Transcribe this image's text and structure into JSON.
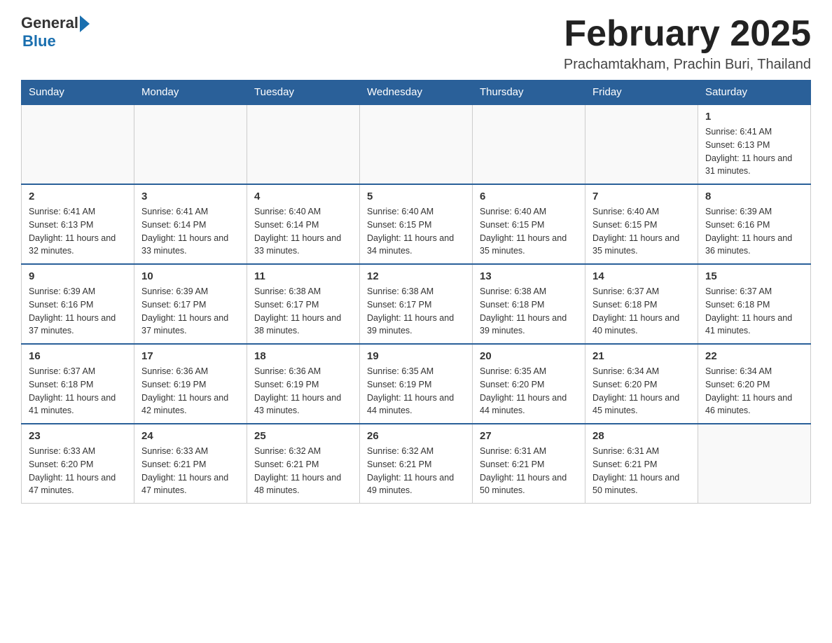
{
  "header": {
    "logo_general": "General",
    "logo_blue": "Blue",
    "month_title": "February 2025",
    "location": "Prachamtakham, Prachin Buri, Thailand"
  },
  "days_of_week": [
    "Sunday",
    "Monday",
    "Tuesday",
    "Wednesday",
    "Thursday",
    "Friday",
    "Saturday"
  ],
  "weeks": [
    {
      "days": [
        {
          "date": "",
          "info": ""
        },
        {
          "date": "",
          "info": ""
        },
        {
          "date": "",
          "info": ""
        },
        {
          "date": "",
          "info": ""
        },
        {
          "date": "",
          "info": ""
        },
        {
          "date": "",
          "info": ""
        },
        {
          "date": "1",
          "info": "Sunrise: 6:41 AM\nSunset: 6:13 PM\nDaylight: 11 hours and 31 minutes."
        }
      ]
    },
    {
      "days": [
        {
          "date": "2",
          "info": "Sunrise: 6:41 AM\nSunset: 6:13 PM\nDaylight: 11 hours and 32 minutes."
        },
        {
          "date": "3",
          "info": "Sunrise: 6:41 AM\nSunset: 6:14 PM\nDaylight: 11 hours and 33 minutes."
        },
        {
          "date": "4",
          "info": "Sunrise: 6:40 AM\nSunset: 6:14 PM\nDaylight: 11 hours and 33 minutes."
        },
        {
          "date": "5",
          "info": "Sunrise: 6:40 AM\nSunset: 6:15 PM\nDaylight: 11 hours and 34 minutes."
        },
        {
          "date": "6",
          "info": "Sunrise: 6:40 AM\nSunset: 6:15 PM\nDaylight: 11 hours and 35 minutes."
        },
        {
          "date": "7",
          "info": "Sunrise: 6:40 AM\nSunset: 6:15 PM\nDaylight: 11 hours and 35 minutes."
        },
        {
          "date": "8",
          "info": "Sunrise: 6:39 AM\nSunset: 6:16 PM\nDaylight: 11 hours and 36 minutes."
        }
      ]
    },
    {
      "days": [
        {
          "date": "9",
          "info": "Sunrise: 6:39 AM\nSunset: 6:16 PM\nDaylight: 11 hours and 37 minutes."
        },
        {
          "date": "10",
          "info": "Sunrise: 6:39 AM\nSunset: 6:17 PM\nDaylight: 11 hours and 37 minutes."
        },
        {
          "date": "11",
          "info": "Sunrise: 6:38 AM\nSunset: 6:17 PM\nDaylight: 11 hours and 38 minutes."
        },
        {
          "date": "12",
          "info": "Sunrise: 6:38 AM\nSunset: 6:17 PM\nDaylight: 11 hours and 39 minutes."
        },
        {
          "date": "13",
          "info": "Sunrise: 6:38 AM\nSunset: 6:18 PM\nDaylight: 11 hours and 39 minutes."
        },
        {
          "date": "14",
          "info": "Sunrise: 6:37 AM\nSunset: 6:18 PM\nDaylight: 11 hours and 40 minutes."
        },
        {
          "date": "15",
          "info": "Sunrise: 6:37 AM\nSunset: 6:18 PM\nDaylight: 11 hours and 41 minutes."
        }
      ]
    },
    {
      "days": [
        {
          "date": "16",
          "info": "Sunrise: 6:37 AM\nSunset: 6:18 PM\nDaylight: 11 hours and 41 minutes."
        },
        {
          "date": "17",
          "info": "Sunrise: 6:36 AM\nSunset: 6:19 PM\nDaylight: 11 hours and 42 minutes."
        },
        {
          "date": "18",
          "info": "Sunrise: 6:36 AM\nSunset: 6:19 PM\nDaylight: 11 hours and 43 minutes."
        },
        {
          "date": "19",
          "info": "Sunrise: 6:35 AM\nSunset: 6:19 PM\nDaylight: 11 hours and 44 minutes."
        },
        {
          "date": "20",
          "info": "Sunrise: 6:35 AM\nSunset: 6:20 PM\nDaylight: 11 hours and 44 minutes."
        },
        {
          "date": "21",
          "info": "Sunrise: 6:34 AM\nSunset: 6:20 PM\nDaylight: 11 hours and 45 minutes."
        },
        {
          "date": "22",
          "info": "Sunrise: 6:34 AM\nSunset: 6:20 PM\nDaylight: 11 hours and 46 minutes."
        }
      ]
    },
    {
      "days": [
        {
          "date": "23",
          "info": "Sunrise: 6:33 AM\nSunset: 6:20 PM\nDaylight: 11 hours and 47 minutes."
        },
        {
          "date": "24",
          "info": "Sunrise: 6:33 AM\nSunset: 6:21 PM\nDaylight: 11 hours and 47 minutes."
        },
        {
          "date": "25",
          "info": "Sunrise: 6:32 AM\nSunset: 6:21 PM\nDaylight: 11 hours and 48 minutes."
        },
        {
          "date": "26",
          "info": "Sunrise: 6:32 AM\nSunset: 6:21 PM\nDaylight: 11 hours and 49 minutes."
        },
        {
          "date": "27",
          "info": "Sunrise: 6:31 AM\nSunset: 6:21 PM\nDaylight: 11 hours and 50 minutes."
        },
        {
          "date": "28",
          "info": "Sunrise: 6:31 AM\nSunset: 6:21 PM\nDaylight: 11 hours and 50 minutes."
        },
        {
          "date": "",
          "info": ""
        }
      ]
    }
  ]
}
